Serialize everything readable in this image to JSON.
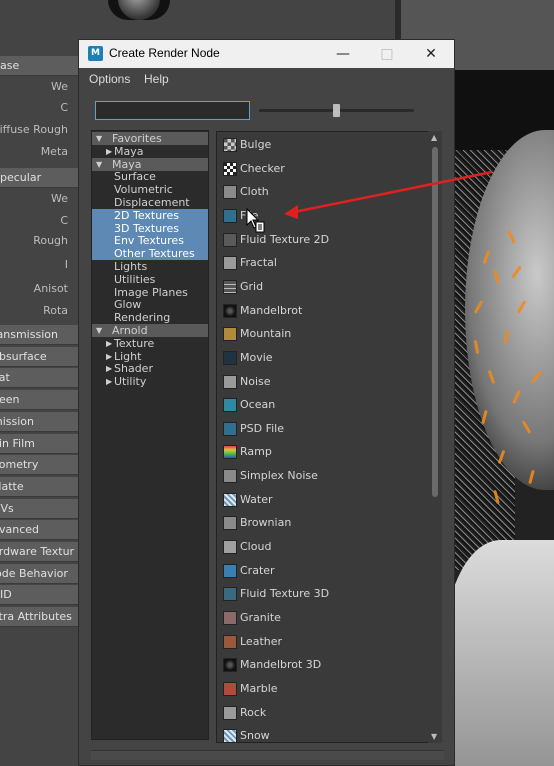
{
  "dialog": {
    "title": "Create Render Node",
    "menu": [
      "Options",
      "Help"
    ],
    "search_placeholder": ""
  },
  "background_editor": {
    "attributes": [
      "ase",
      "We",
      "C",
      "Diffuse Rough",
      "Meta",
      "pecular",
      "We",
      "C",
      "Rough",
      "I",
      "Anisot",
      "Rota"
    ],
    "sections": [
      "ransmission",
      "ubsurface",
      "oat",
      "heen",
      "mission",
      "hin Film",
      "eometry",
      "Matte",
      "OVs",
      "dvanced",
      "ardware Textur",
      "lode Behavior",
      "UID",
      "xtra Attributes"
    ]
  },
  "tree": [
    {
      "label": "Favorites",
      "type": "category",
      "expanded": true
    },
    {
      "label": "Maya",
      "type": "child-collapsed"
    },
    {
      "label": "Maya",
      "type": "category",
      "expanded": true
    },
    {
      "label": "Surface",
      "type": "item"
    },
    {
      "label": "Volumetric",
      "type": "item"
    },
    {
      "label": "Displacement",
      "type": "item"
    },
    {
      "label": "2D Textures",
      "type": "item",
      "selected": true
    },
    {
      "label": "3D Textures",
      "type": "item",
      "selected": true
    },
    {
      "label": "Env Textures",
      "type": "item",
      "selected": true
    },
    {
      "label": "Other Textures",
      "type": "item",
      "selected": true
    },
    {
      "label": "Lights",
      "type": "item"
    },
    {
      "label": "Utilities",
      "type": "item"
    },
    {
      "label": "Image Planes",
      "type": "item"
    },
    {
      "label": "Glow",
      "type": "item"
    },
    {
      "label": "Rendering",
      "type": "item"
    },
    {
      "label": "Arnold",
      "type": "category",
      "expanded": true
    },
    {
      "label": "Texture",
      "type": "child-collapsed"
    },
    {
      "label": "Light",
      "type": "child-collapsed"
    },
    {
      "label": "Shader",
      "type": "child-collapsed"
    },
    {
      "label": "Utility",
      "type": "child-collapsed"
    }
  ],
  "nodes": [
    {
      "label": "Bulge",
      "icon": "bulge-icon",
      "color": "#6a6a6a"
    },
    {
      "label": "Checker",
      "icon": "checker-icon",
      "color": "#ffffff"
    },
    {
      "label": "Cloth",
      "icon": "cloth-icon",
      "color": "#8a8a8a"
    },
    {
      "label": "File",
      "icon": "file-icon",
      "color": "#2f6f8f"
    },
    {
      "label": "Fluid Texture 2D",
      "icon": "fluid-texture-2d-icon",
      "color": "#5a5a5a"
    },
    {
      "label": "Fractal",
      "icon": "fractal-icon",
      "color": "#9a9a9a"
    },
    {
      "label": "Grid",
      "icon": "grid-icon",
      "color": "#5c5c5c"
    },
    {
      "label": "Mandelbrot",
      "icon": "mandelbrot-icon",
      "color": "#1e1e1e"
    },
    {
      "label": "Mountain",
      "icon": "mountain-icon",
      "color": "#b38a3c"
    },
    {
      "label": "Movie",
      "icon": "movie-icon",
      "color": "#1f3440"
    },
    {
      "label": "Noise",
      "icon": "noise-icon",
      "color": "#9a9a9a"
    },
    {
      "label": "Ocean",
      "icon": "ocean-icon",
      "color": "#2d8aa0"
    },
    {
      "label": "PSD File",
      "icon": "psd-file-icon",
      "color": "#2f6f8f"
    },
    {
      "label": "Ramp",
      "icon": "ramp-icon",
      "color": "#4caf50"
    },
    {
      "label": "Simplex Noise",
      "icon": "simplex-noise-icon",
      "color": "#8a8a8a"
    },
    {
      "label": "Water",
      "icon": "water-icon",
      "color": "#7fa6c6"
    },
    {
      "label": "Brownian",
      "icon": "brownian-icon",
      "color": "#8a8a8a"
    },
    {
      "label": "Cloud",
      "icon": "cloud-icon",
      "color": "#a0a0a0"
    },
    {
      "label": "Crater",
      "icon": "crater-icon",
      "color": "#3a7fb0"
    },
    {
      "label": "Fluid Texture 3D",
      "icon": "fluid-texture-3d-icon",
      "color": "#3a6a80"
    },
    {
      "label": "Granite",
      "icon": "granite-icon",
      "color": "#8a6a6a"
    },
    {
      "label": "Leather",
      "icon": "leather-icon",
      "color": "#9a5a3a"
    },
    {
      "label": "Mandelbrot 3D",
      "icon": "mandelbrot-3d-icon",
      "color": "#151515"
    },
    {
      "label": "Marble",
      "icon": "marble-icon",
      "color": "#b04a3a"
    },
    {
      "label": "Rock",
      "icon": "rock-icon",
      "color": "#9a9a9a"
    },
    {
      "label": "Snow",
      "icon": "snow-icon",
      "color": "#7fa6c6"
    }
  ],
  "colors": {
    "selection": "#5e89b5",
    "annotation_arrow": "#e02020",
    "accent_orange": "#f08a1c"
  }
}
